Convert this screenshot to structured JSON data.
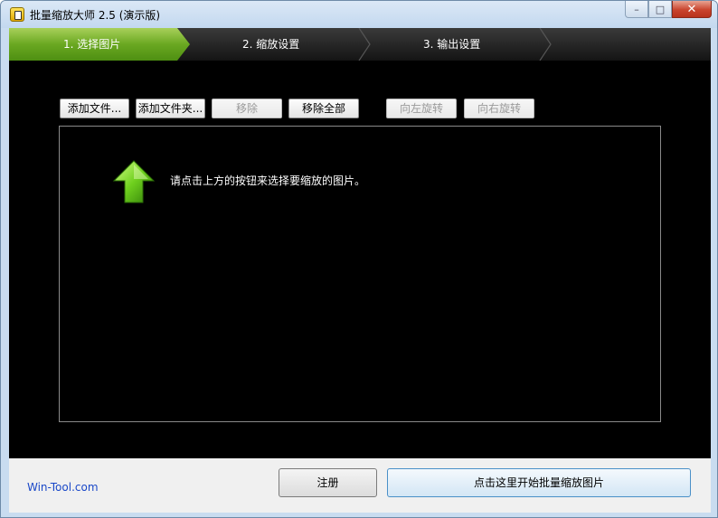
{
  "window": {
    "title": "批量缩放大师 2.5 (演示版)"
  },
  "caption": {
    "minimize": "–",
    "maximize": "□",
    "close": "✕"
  },
  "steps": [
    {
      "label": "1. 选择图片",
      "active": true
    },
    {
      "label": "2. 缩放设置",
      "active": false
    },
    {
      "label": "3. 输出设置",
      "active": false
    }
  ],
  "toolbar": {
    "add_file": "添加文件...",
    "add_folder": "添加文件夹...",
    "remove": "移除",
    "remove_all": "移除全部",
    "rotate_left": "向左旋转",
    "rotate_right": "向右旋转"
  },
  "panel": {
    "hint": "请点击上方的按钮来选择要缩放的图片。",
    "icon": "green-up-arrow-icon"
  },
  "footer": {
    "brand": "Win-Tool.com",
    "register": "注册",
    "start": "点击这里开始批量缩放图片"
  },
  "colors": {
    "accent_green": "#6aa821",
    "link_blue": "#1a48c8",
    "background": "#000000"
  }
}
